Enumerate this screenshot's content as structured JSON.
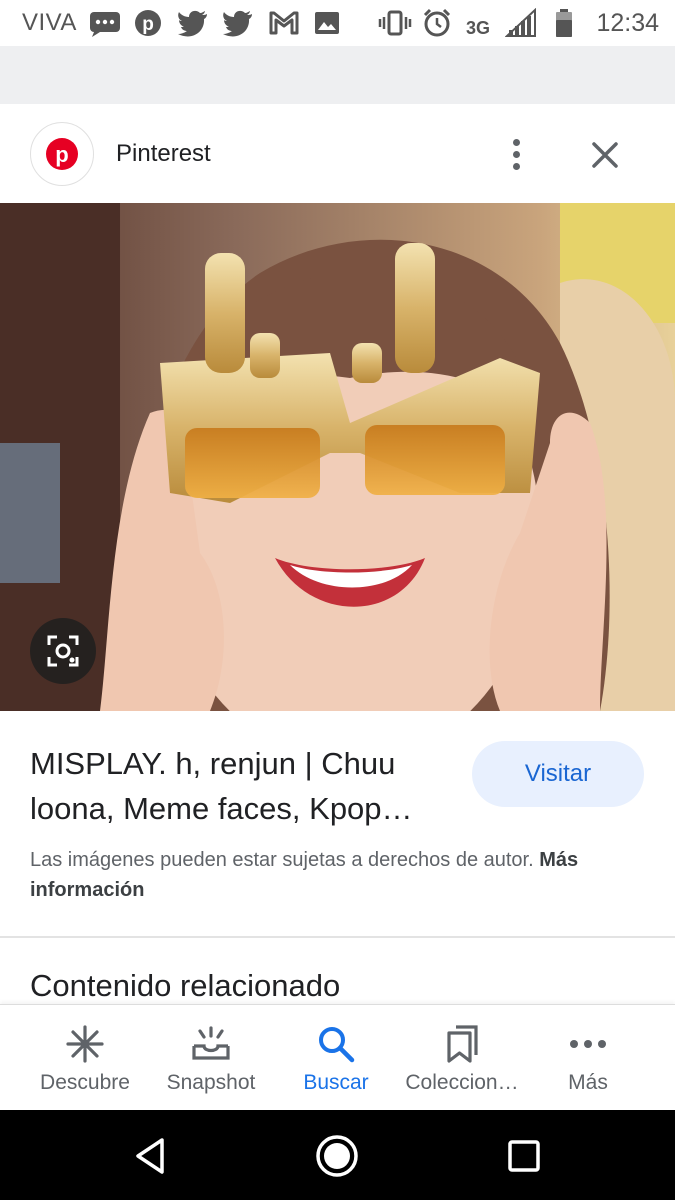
{
  "status_bar": {
    "carrier": "VIVA",
    "network": "3G",
    "time": "12:34",
    "icons": [
      "messages-icon",
      "pinterest-icon",
      "twitter-icon",
      "twitter-icon",
      "gmail-icon",
      "gallery-icon",
      "vibrate-icon",
      "alarm-icon",
      "signal-icon",
      "battery-icon"
    ]
  },
  "header": {
    "source_name": "Pinterest",
    "logo_icon": "pinterest-logo-icon",
    "brand_color": "#e60023"
  },
  "image": {
    "lens_icon": "lens-icon"
  },
  "result": {
    "title": "MISPLAY. h, renjun | Chuu loona, Meme faces, Kpop…",
    "visit_label": "Visitar",
    "copyright_text": "Las imágenes pueden estar sujetas a derechos de autor.",
    "more_info_label": "Más información"
  },
  "related": {
    "heading": "Contenido relacionado"
  },
  "bottom_nav": {
    "items": [
      {
        "label": "Descubre",
        "icon": "asterisk-icon"
      },
      {
        "label": "Snapshot",
        "icon": "snapshot-icon"
      },
      {
        "label": "Buscar",
        "icon": "search-icon"
      },
      {
        "label": "Coleccion…",
        "icon": "collections-icon"
      },
      {
        "label": "Más",
        "icon": "more-horizontal-icon"
      }
    ],
    "active_index": 2,
    "active_color": "#1a73e8"
  },
  "system_nav": {
    "icons": [
      "back-icon",
      "home-icon",
      "recents-icon"
    ]
  }
}
